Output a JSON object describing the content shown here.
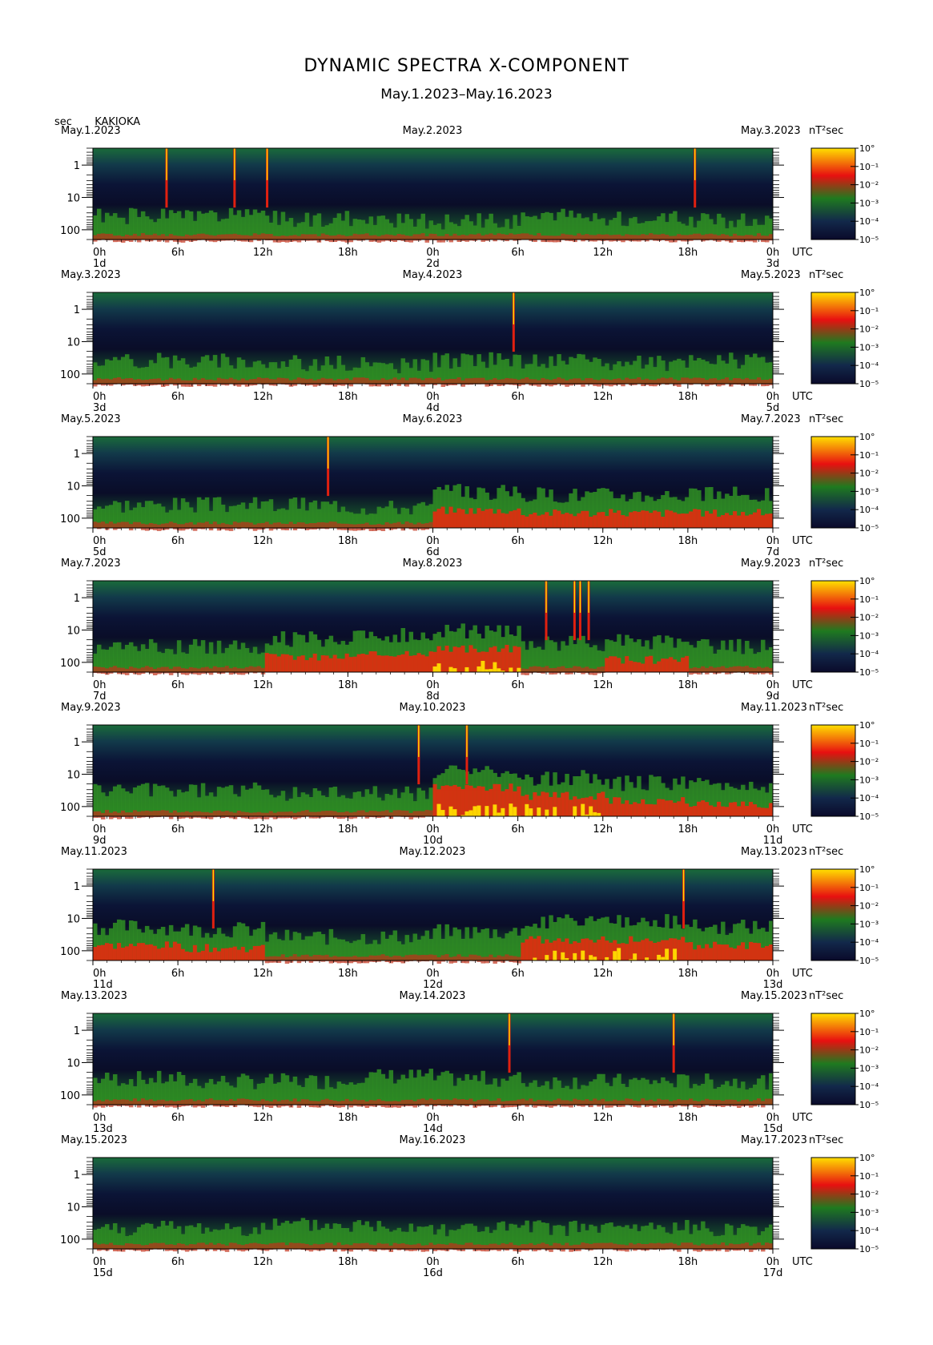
{
  "title": "DYNAMIC SPECTRA X-COMPONENT",
  "subtitle": "May.1.2023–May.16.2023",
  "station_unit": "sec",
  "station": "KAKIOKA",
  "unit_label": "nT²sec",
  "time_zone": "UTC",
  "colors": {
    "low": "#0a0a2a",
    "mid": "#1f7a1f",
    "high": "#e81010",
    "peak": "#ffe000"
  },
  "chart_data": {
    "type": "heatmap",
    "y_axis": {
      "label": "sec",
      "ticks": [
        "1",
        "10",
        "100"
      ],
      "scale": "log",
      "range": [
        0.3,
        200
      ]
    },
    "colorbar": {
      "scale": "log",
      "range": [
        1e-05,
        1
      ],
      "ticks": [
        "10°",
        "10⁻¹",
        "10⁻²",
        "10⁻³",
        "10⁻⁴",
        "10⁻⁵"
      ]
    },
    "x_ticks": [
      "0h",
      "6h",
      "12h",
      "18h",
      "0h",
      "6h",
      "12h",
      "18h",
      "0h"
    ],
    "panels": [
      {
        "date_left": "May.1.2023",
        "date_mid": "May.2.2023",
        "date_right": "May.3.2023",
        "day_left": "1d",
        "day_mid": "2d",
        "day_right": "3d",
        "activity": [
          0.3,
          0.3,
          0.25,
          0.2,
          0.2,
          0.3,
          0.25,
          0.2
        ],
        "spikes": [
          5.2,
          10,
          12.3,
          42.5
        ]
      },
      {
        "date_left": "May.3.2023",
        "date_mid": "May.4.2023",
        "date_right": "May.5.2023",
        "day_left": "3d",
        "day_mid": "4d",
        "day_right": "5d",
        "activity": [
          0.3,
          0.3,
          0.25,
          0.2,
          0.3,
          0.3,
          0.25,
          0.3
        ],
        "spikes": [
          29.7
        ]
      },
      {
        "date_left": "May.5.2023",
        "date_mid": "May.6.2023",
        "date_right": "May.7.2023",
        "day_left": "5d",
        "day_mid": "6d",
        "day_right": "7d",
        "activity": [
          0.3,
          0.3,
          0.3,
          0.25,
          0.55,
          0.5,
          0.5,
          0.5
        ],
        "spikes": [
          16.6
        ]
      },
      {
        "date_left": "May.7.2023",
        "date_mid": "May.8.2023",
        "date_right": "May.9.2023",
        "day_left": "7d",
        "day_mid": "8d",
        "day_right": "9d",
        "activity": [
          0.35,
          0.35,
          0.5,
          0.55,
          0.65,
          0.4,
          0.45,
          0.35
        ],
        "spikes": [
          32,
          34,
          34.4,
          35
        ]
      },
      {
        "date_left": "May.9.2023",
        "date_mid": "May.10.2023",
        "date_right": "May.11.2023",
        "day_left": "9d",
        "day_mid": "10d",
        "day_right": "11d",
        "activity": [
          0.35,
          0.35,
          0.3,
          0.3,
          0.75,
          0.6,
          0.5,
          0.45
        ],
        "spikes": [
          23,
          26.4
        ]
      },
      {
        "date_left": "May.11.2023",
        "date_mid": "May.12.2023",
        "date_right": "May.13.2023",
        "day_left": "11d",
        "day_mid": "12d",
        "day_right": "13d",
        "activity": [
          0.5,
          0.45,
          0.3,
          0.3,
          0.4,
          0.6,
          0.6,
          0.5
        ],
        "spikes": [
          8.5,
          41.7
        ]
      },
      {
        "date_left": "May.13.2023",
        "date_mid": "May.14.2023",
        "date_right": "May.15.2023",
        "day_left": "13d",
        "day_mid": "14d",
        "day_right": "15d",
        "activity": [
          0.35,
          0.3,
          0.3,
          0.4,
          0.35,
          0.3,
          0.3,
          0.3
        ],
        "spikes": [
          29.4,
          41
        ]
      },
      {
        "date_left": "May.15.2023",
        "date_mid": "May.16.2023",
        "date_right": "May.17.2023",
        "day_left": "15d",
        "day_mid": "16d",
        "day_right": "17d",
        "activity": [
          0.25,
          0.25,
          0.3,
          0.3,
          0.25,
          0.25,
          0.25,
          0.25
        ],
        "spikes": []
      }
    ]
  }
}
